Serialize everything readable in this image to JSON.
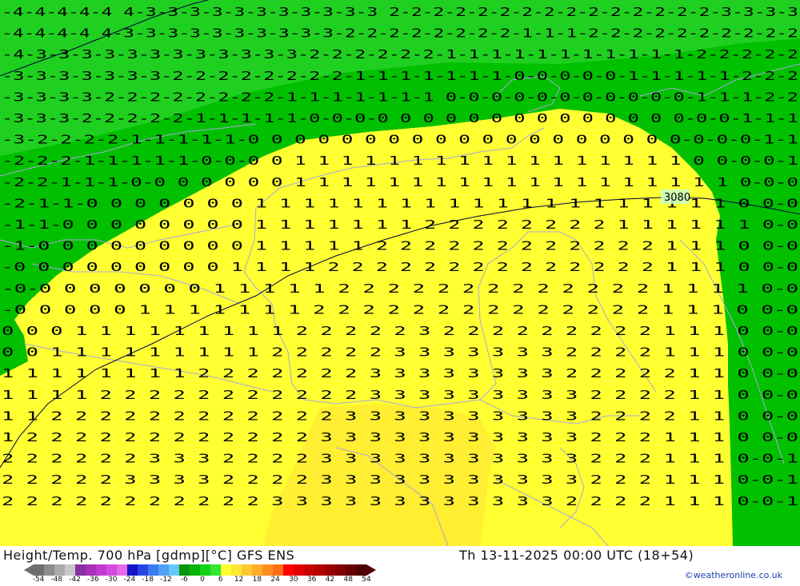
{
  "header": {
    "title": "Height/Temp. 700 hPa [gdmp][°C] GFS ENS",
    "datetime": "Th 13-11-2025 00:00 UTC (18+54)",
    "credit": "©weatheronline.co.uk"
  },
  "map": {
    "contour_label": "3080",
    "temperature_rows": [
      "-4-4-4-4-4 4-3-3-3-3-3-3-3-3-3-3-3 2-2-2-2-2-2-2-2-2-2-2-2-2-2-2-3-3-3-3",
      "-4-4-4-4 4-3-3-3-3-3-3-3-3-3-3-2-2-2-2-2-2-2-2-1-1-1-2-2-2-2-2-2-2-2-2-2",
      "-4-3-3-3-3-3-3-3-3-3-3-3-3-2-2-2-2-2-2-1-1-1-1-1-1-1-1-1-1-1-2-2-2-2-2",
      "-3-3-3-3-3-3-3-2-2-2-2-2-2-2-2-1-1-1-1-1-1-1-0-0-0-0-0-1-1-1-1-1-2-2-2",
      "-3-3-3-3-2-2-2-2-2-2-2-2-1-1-1-1-1-1-1 0-0-0-0-0-0-0-0-0-0-0-1-1-1-2-2",
      "-3-3-3-2-2-2-2-2-1-1-1-1-1-0-0-0-0 0 0 0 0 0 0 0 0 0 0 0 0 0-0-0-1-1-1",
      "-3-2-2-2-2-1-1-1-1-1-0 0 0 0 0 0 0 0 0 0 0 0 0 0 0 0 0 0 0-0-0-0-1-1",
      "-2-2-2-1-1-1-1-1-0-0-0 0 1 1 1 1 1 1 1 1 1 1 1 1 1 1 1 1 1 0 0-0-0-1",
      "-2-2-1-1-1-0-0 0 0 0 0 0 1 1 1 1 1 1 1 1 1 1 1 1 1 1 1 1 1 1 1 0-0-0",
      "-2-1-1-0 0 0 0 0 0 0 1 1 1 1 1 1 1 1 1 1 1 1 1 1 1 1 1 1 1 1 0 0-0",
      "-1-1-0 0 0 0 0 0 0 0 1 1 1 1 1 1 1 2 2 2 2 2 2 2 2 1 1 1 1 1 1 0-0",
      "-1-0 0 0 0 0 0 0 0 0 1 1 1 1 1 2 2 2 2 2 2 2 2 2 2 2 2 1 1 1 0 0-0",
      "-0 0 0 0 0 0 0 0 0 1 1 1 1 2 2 2 2 2 2 2 2 2 2 2 2 2 2 1 1 1 0 0-0",
      "-0-0 0 0 0 0 0 0 1 1 1 1 1 2 2 2 2 2 2 2 2 2 2 2 2 2 1 1 1 1 0-0",
      "-0 0 0 0 0 1 1 1 1 1 1 1 2 2 2 2 2 2 2 2 2 2 2 2 2 2 1 1 1 0 0-0",
      "0 0 0 1 1 1 1 1 1 1 1 1 2 2 2 2 2 3 2 2 2 2 2 2 2 2 2 1 1 1 0 0-0",
      "0 0 1 1 1 1 1 1 1 1 1 2 2 2 2 2 3 3 3 3 3 3 3 2 2 2 2 1 1 1 0 0-0",
      "1 1 1 1 1 1 1 1 2 2 2 2 2 2 2 3 3 3 3 3 3 3 3 2 2 2 2 2 1 1 0 0-0",
      "1 1 1 1 2 2 2 2 2 2 2 2 2 2 2 3 3 3 3 3 3 3 3 3 2 2 2 2 1 1 0 0-0",
      "1 1 2 2 2 2 2 2 2 2 2 2 2 2 3 3 3 3 3 3 3 3 3 3 2 2 2 2 1 1 0 0-0",
      "1 2 2 2 2 2 2 2 2 2 2 2 2 3 3 3 3 3 3 3 3 3 3 3 2 2 2 1 1 1 0 0-0",
      "2 2 2 2 2 2 3 3 3 2 2 2 2 3 3 3 3 3 3 3 3 3 3 3 2 2 2 1 1 1 0-0-1",
      "2 2 2 2 2 3 3 3 3 2 2 2 2 3 3 3 3 3 3 3 3 3 3 3 2 2 2 1 1 1 0-0-1",
      "2 2 2 2 2 2 2 2 2 2 2 3 3 3 3 3 3 3 3 3 3 3 3 2 2 2 2 1 1 1 0-0-1"
    ]
  },
  "legend": {
    "ticks": [
      "-54",
      "-48",
      "-42",
      "-36",
      "-30",
      "-24",
      "-18",
      "-12",
      "-6",
      "0",
      "6",
      "12",
      "18",
      "24",
      "30",
      "36",
      "42",
      "48",
      "54"
    ],
    "colors": [
      "#6e6e6e",
      "#8c8c8c",
      "#aaaaaa",
      "#c8c8c8",
      "#8a2fa0",
      "#a82fb8",
      "#c23ad0",
      "#d44cdc",
      "#e46ae8",
      "#1414c8",
      "#2846e6",
      "#3c78f0",
      "#50a0f5",
      "#64c8fa",
      "#0a960a",
      "#0ab40a",
      "#14d214",
      "#32e632",
      "#ffff32",
      "#ffe632",
      "#ffc832",
      "#ffaa28",
      "#ff8c1e",
      "#ff6e14",
      "#ff0000",
      "#e10000",
      "#c80000",
      "#b40000",
      "#9b0000",
      "#820000",
      "#690000",
      "#500000"
    ]
  }
}
